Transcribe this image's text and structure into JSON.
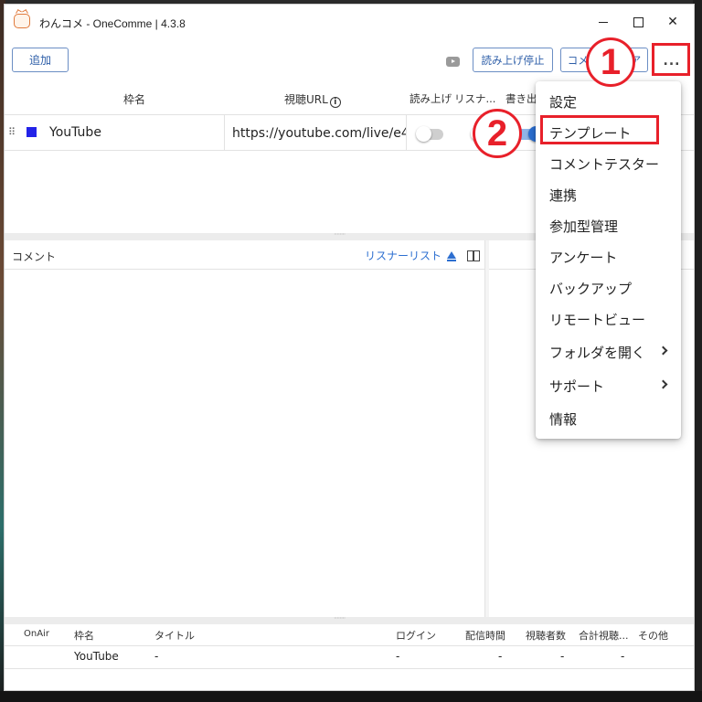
{
  "window": {
    "title": "わんコメ - OneComme | 4.3.8"
  },
  "toolbar": {
    "add_label": "追加",
    "tts_stop_label": "読み上げ停止",
    "comment_clear_label": "コメントクリア",
    "more_label": "..."
  },
  "services_table": {
    "headers": {
      "frame_name": "枠名",
      "url": "視聴URL",
      "read_aloud": "読み上げ",
      "listener": "リスナ...",
      "write": "書き出"
    },
    "rows": [
      {
        "name": "YouTube",
        "url": "https://youtube.com/live/e4",
        "color": "#2323e8",
        "read_aloud_on": false,
        "listener_on": false,
        "write_on": true
      }
    ]
  },
  "comment_pane": {
    "title": "コメント",
    "listener_list_link": "リスナーリスト"
  },
  "menu": {
    "items": [
      {
        "label": "設定",
        "has_submenu": false
      },
      {
        "label": "テンプレート",
        "has_submenu": false
      },
      {
        "label": "コメントテスター",
        "has_submenu": false
      },
      {
        "label": "連携",
        "has_submenu": false
      },
      {
        "label": "参加型管理",
        "has_submenu": false
      },
      {
        "label": "アンケート",
        "has_submenu": false
      },
      {
        "label": "バックアップ",
        "has_submenu": false
      },
      {
        "label": "リモートビュー",
        "has_submenu": false
      },
      {
        "label": "フォルダを開く",
        "has_submenu": true
      },
      {
        "label": "サポート",
        "has_submenu": true
      },
      {
        "label": "情報",
        "has_submenu": false
      }
    ]
  },
  "annotations": {
    "step1": "1",
    "step2": "2",
    "highlight_color": "#e8202a"
  },
  "bottom_table": {
    "headers": {
      "onair": "OnAir",
      "frame": "枠名",
      "title": "タイトル",
      "login": "ログイン",
      "duration": "配信時間",
      "viewers": "視聴者数",
      "total_viewers": "合計視聴...",
      "other": "その他"
    },
    "rows": [
      {
        "frame": "YouTube",
        "title": "-",
        "login": "-",
        "duration": "-",
        "viewers": "-",
        "total_viewers": "-"
      }
    ]
  },
  "colors": {
    "accent": "#2d6fd0",
    "button_border": "#6b8ec4"
  }
}
